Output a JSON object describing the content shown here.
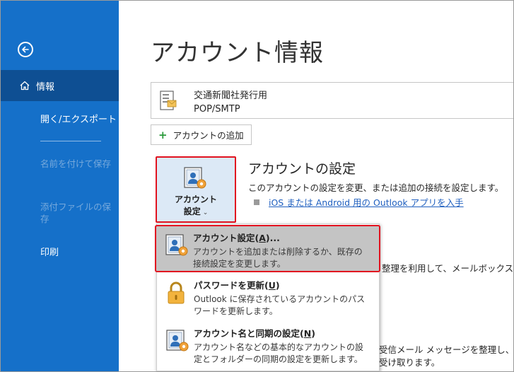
{
  "sidebar": {
    "nav_info": "情報",
    "nav_open_export": "開く/エクスポート",
    "nav_save_as": "名前を付けて保存",
    "nav_save_attachments": "添付ファイルの保存",
    "nav_print": "印刷"
  },
  "main": {
    "title": "アカウント情報",
    "account": {
      "name": "交通新聞社発行用",
      "type": "POP/SMTP"
    },
    "add_account": "アカウントの追加",
    "settings_tile": {
      "line1": "アカウント",
      "line2": "設定",
      "chevron": "⌄"
    },
    "section": {
      "title": "アカウントの設定",
      "description": "このアカウントの設定を変更、または追加の接続を設定します。",
      "link": "iOS または Android 用の Outlook アプリを入手"
    },
    "background_text": {
      "line1": "整理を利用して、メールボックスのサイ",
      "line2": "受信メール メッセージを整理し、アイ",
      "line3": "受け取ります。"
    }
  },
  "dropdown": {
    "items": [
      {
        "title": "アカウント設定(A)...",
        "title_pre": "アカウント設定(",
        "title_key": "A",
        "title_post": ")...",
        "d1": "アカウントを追加または削除するか、既存の",
        "d2": "接続設定を変更します。"
      },
      {
        "title_pre": "パスワードを更新(",
        "title_key": "U",
        "title_post": ")",
        "d1": "Outlook に保存されているアカウントのパス",
        "d2": "ワードを更新します。"
      },
      {
        "title_pre": "アカウント名と同期の設定(",
        "title_key": "N",
        "title_post": ")",
        "d1": "アカウント名などの基本的なアカウントの設",
        "d2": "定とフォルダーの同期の設定を更新します。"
      }
    ]
  },
  "colors": {
    "sidebar": "#1570c9",
    "sidebar_active": "#0e4f93",
    "highlight_border": "#e1121f",
    "link": "#1f5fbf"
  }
}
